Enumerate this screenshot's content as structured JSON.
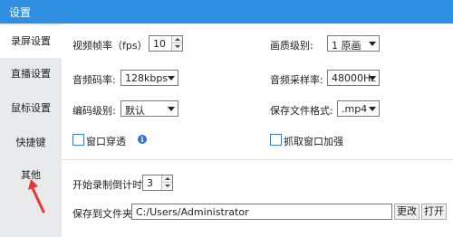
{
  "window": {
    "title": "设置"
  },
  "sidebar": {
    "items": [
      {
        "label": "录屏设置"
      },
      {
        "label": "直播设置"
      },
      {
        "label": "鼠标设置"
      },
      {
        "label": "快捷键"
      },
      {
        "label": "其他"
      }
    ],
    "active_index": 0
  },
  "recording": {
    "fps_label": "视频帧率（fps）:",
    "fps_value": "10",
    "quality_label": "画质级别:",
    "quality_value": "1 原画",
    "audio_bitrate_label": "音频码率:",
    "audio_bitrate_value": "128kbps",
    "sample_rate_label": "音频采样率:",
    "sample_rate_value": "48000Hz",
    "encode_label": "编码级别:",
    "encode_value": "默认",
    "format_label": "保存文件格式:",
    "format_value": ".mp4",
    "window_through_label": "窗口穿透",
    "capture_enhance_label": "抓取窗口加强",
    "countdown_label": "开始录制倒计时:",
    "countdown_value": "3",
    "save_folder_label": "保存到文件夹:",
    "save_folder_value": "C:/Users/Administrator",
    "change_button": "更改",
    "open_button": "打开"
  },
  "colors": {
    "titlebar": "#2f8fe0",
    "annotation_arrow": "#e53935"
  },
  "icons": {
    "info": "info-icon"
  }
}
